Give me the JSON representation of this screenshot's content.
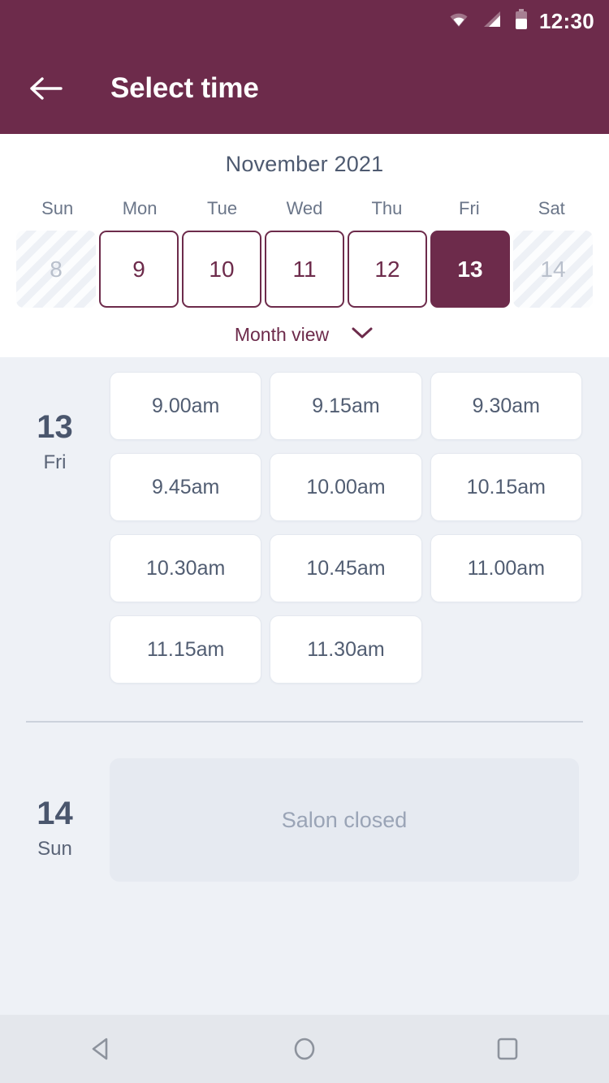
{
  "status_bar": {
    "time": "12:30",
    "icons": [
      "wifi-icon",
      "signal-icon",
      "battery-icon"
    ]
  },
  "app_bar": {
    "back_icon": "back-arrow-icon",
    "title": "Select time"
  },
  "calendar": {
    "month_title": "November 2021",
    "weekdays": [
      "Sun",
      "Mon",
      "Tue",
      "Wed",
      "Thu",
      "Fri",
      "Sat"
    ],
    "days": [
      {
        "number": "8",
        "state": "disabled"
      },
      {
        "number": "9",
        "state": "available"
      },
      {
        "number": "10",
        "state": "available"
      },
      {
        "number": "11",
        "state": "available"
      },
      {
        "number": "12",
        "state": "available"
      },
      {
        "number": "13",
        "state": "selected"
      },
      {
        "number": "14",
        "state": "disabled"
      }
    ],
    "month_view_label": "Month view",
    "month_view_icon": "chevron-down-icon"
  },
  "slot_groups": [
    {
      "day_number": "13",
      "day_name": "Fri",
      "slots": [
        "9.00am",
        "9.15am",
        "9.30am",
        "9.45am",
        "10.00am",
        "10.15am",
        "10.30am",
        "10.45am",
        "11.00am",
        "11.15am",
        "11.30am"
      ]
    },
    {
      "day_number": "14",
      "day_name": "Sun",
      "closed_message": "Salon closed"
    }
  ],
  "nav_bar": {
    "back": "nav-back-icon",
    "home": "nav-home-icon",
    "recents": "nav-recents-icon"
  },
  "colors": {
    "brand": "#6d2b4b",
    "page_bg": "#eef1f6",
    "card_bg": "#ffffff",
    "text_dark": "#4e5a70",
    "text_muted": "#9aa4b6"
  }
}
